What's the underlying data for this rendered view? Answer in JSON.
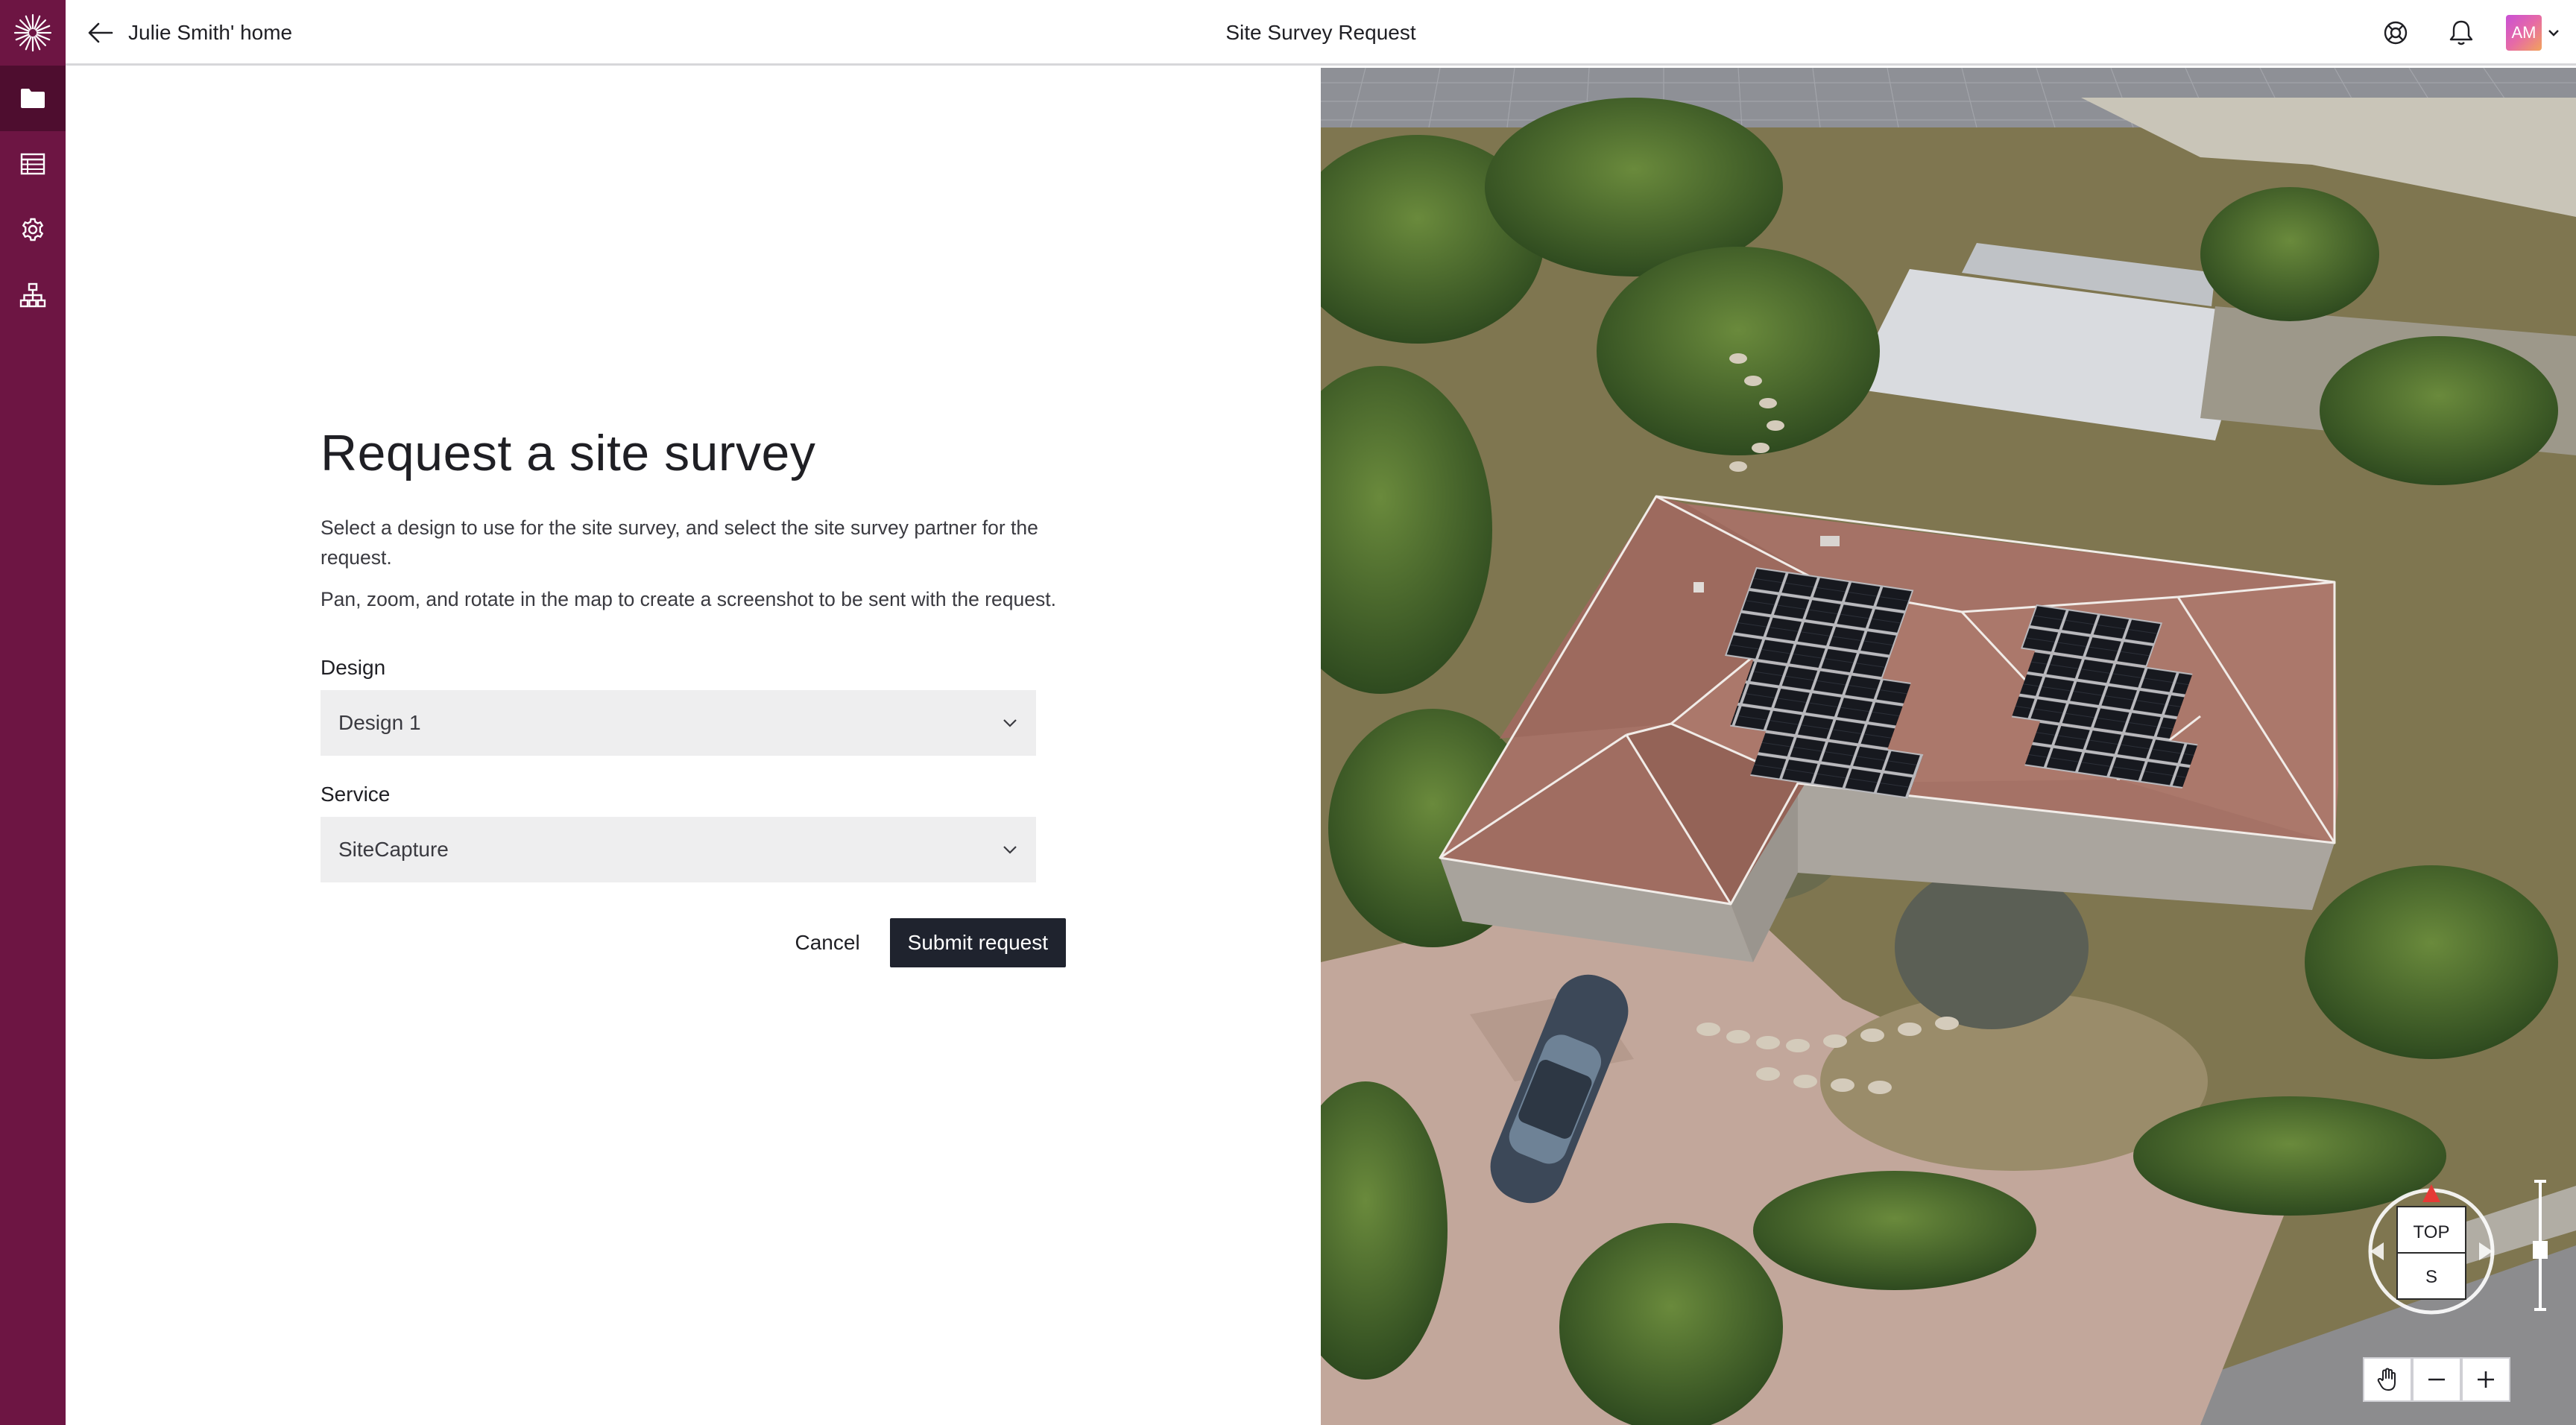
{
  "header": {
    "back_label": "Julie Smith' home",
    "title": "Site Survey Request",
    "avatar_initials": "AM"
  },
  "sidebar": {
    "items": [
      {
        "icon": "folder-icon",
        "active": true
      },
      {
        "icon": "table-icon",
        "active": false
      },
      {
        "icon": "gear-icon",
        "active": false
      },
      {
        "icon": "org-chart-icon",
        "active": false
      }
    ]
  },
  "form": {
    "heading": "Request a site survey",
    "description_1": "Select a design to use for the site survey, and select the site survey partner for the request.",
    "description_2": "Pan, zoom, and rotate in the map to create a screenshot to be sent with the request.",
    "design_label": "Design",
    "design_value": "Design 1",
    "service_label": "Service",
    "service_value": "SiteCapture",
    "cancel_label": "Cancel",
    "submit_label": "Submit request"
  },
  "map": {
    "compass_top": "TOP",
    "compass_direction": "S"
  },
  "colors": {
    "rail": "#6d1543",
    "rail_active": "#4e0d2f",
    "submit": "#1f232e",
    "select_bg": "#eeeeef"
  }
}
